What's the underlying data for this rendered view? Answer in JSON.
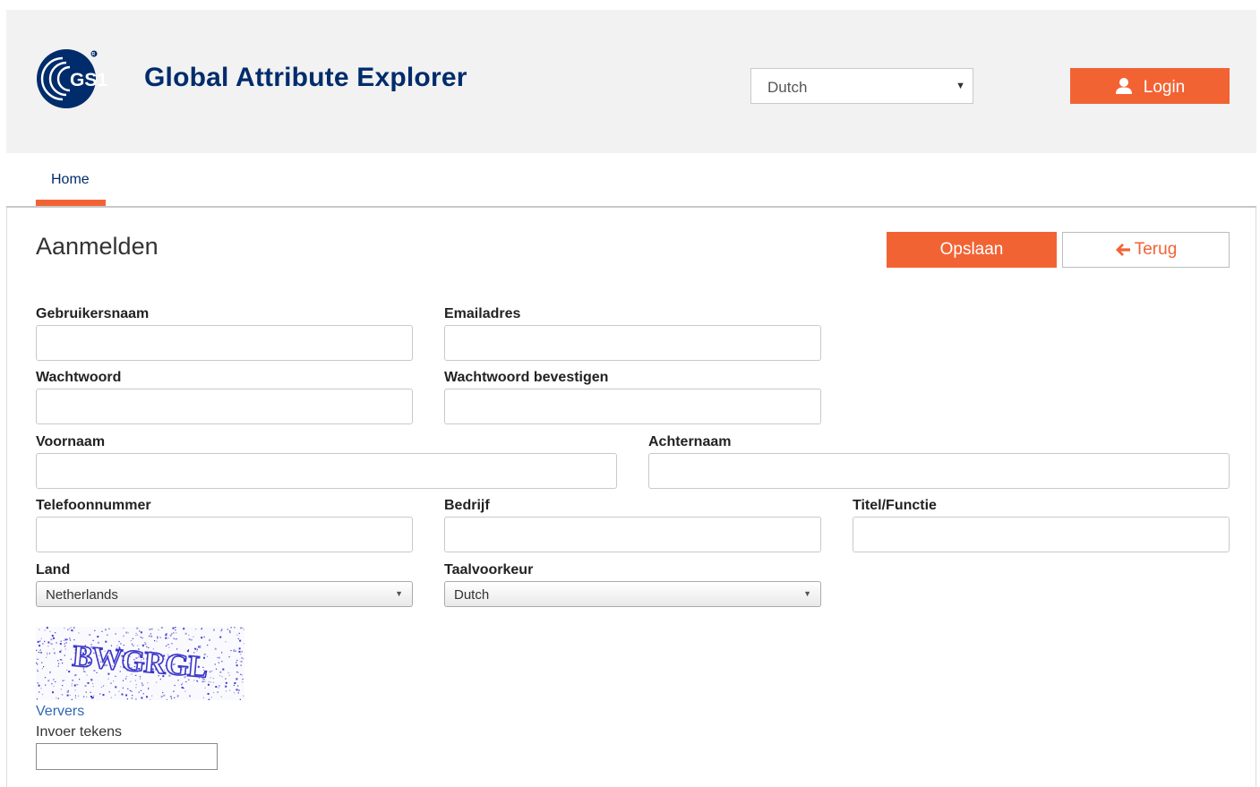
{
  "header": {
    "logo_text": "GS1",
    "app_title": "Global Attribute Explorer",
    "language_selected": "Dutch",
    "login_label": "Login"
  },
  "nav": {
    "tabs": [
      {
        "label": "Home",
        "active": true
      }
    ]
  },
  "page": {
    "title": "Aanmelden",
    "save_label": "Opslaan",
    "back_label": "Terug"
  },
  "form": {
    "username_label": "Gebruikersnaam",
    "email_label": "Emailadres",
    "password_label": "Wachtwoord",
    "password_confirm_label": "Wachtwoord bevestigen",
    "firstname_label": "Voornaam",
    "lastname_label": "Achternaam",
    "phone_label": "Telefoonnummer",
    "company_label": "Bedrijf",
    "jobtitle_label": "Titel/Functie",
    "country_label": "Land",
    "country_value": "Netherlands",
    "language_pref_label": "Taalvoorkeur",
    "language_pref_value": "Dutch"
  },
  "captcha": {
    "code_text": "BWGRGL",
    "refresh_label": "Ververs",
    "input_label": "Invoer tekens"
  },
  "colors": {
    "accent": "#f26334",
    "brand_navy": "#002c6c",
    "header_bg": "#f2f2f2",
    "link": "#2f68b0"
  }
}
